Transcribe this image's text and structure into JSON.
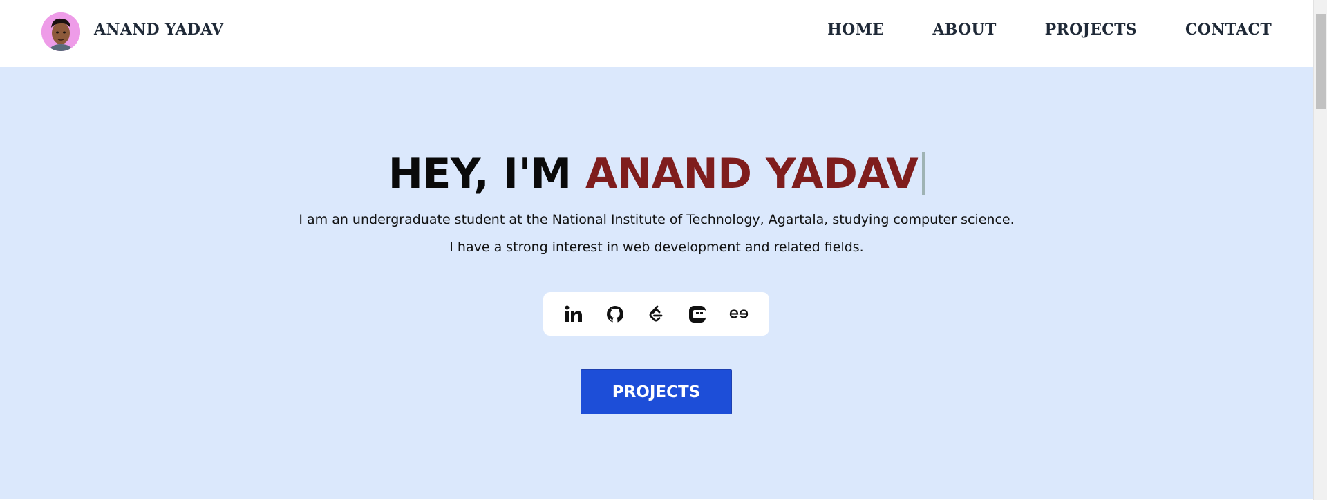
{
  "header": {
    "brand": "ANAND YADAV",
    "nav": [
      "HOME",
      "ABOUT",
      "PROJECTS",
      "CONTACT"
    ]
  },
  "hero": {
    "greeting": "HEY, I'M ",
    "name": "ANAND YADAV",
    "description_line1": "I am an undergraduate student at the National Institute of Technology, Agartala, studying computer science.",
    "description_line2": "I have a strong interest in web development and related fields.",
    "socials": [
      "linkedin-icon",
      "github-icon",
      "leetcode-icon",
      "codechef-icon",
      "geeksforgeeks-icon"
    ],
    "cta_label": "PROJECTS"
  },
  "colors": {
    "hero_bg": "#dbe8fc",
    "name_color": "#7f1d1d",
    "cta_bg": "#1d4ed8",
    "avatar_bg": "#ee9ce8"
  }
}
